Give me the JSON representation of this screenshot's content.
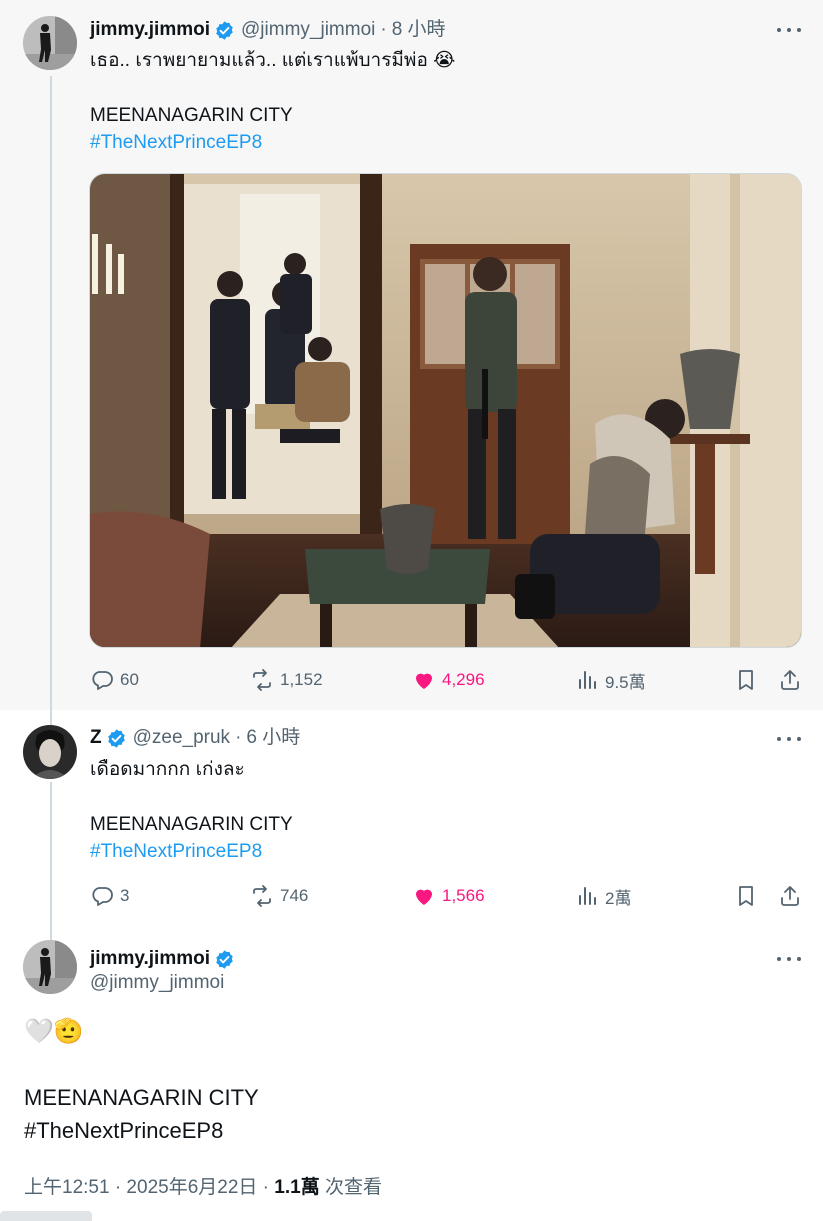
{
  "tweets": [
    {
      "display_name": "jimmy.jimmoi",
      "handle": "@jimmy_jimmoi",
      "time": "8 小時",
      "text_line1": "เธอ.. เราพยายามแล้ว.. แต่เราแพ้บารมีพ่อ 😭",
      "text_line2": "MEENANAGARIN CITY",
      "hashtag": "#TheNextPrinceEP8",
      "replies": "60",
      "retweets": "1,152",
      "likes": "4,296",
      "views": "9.5萬"
    },
    {
      "display_name": "Z",
      "handle": "@zee_pruk",
      "time": "6 小時",
      "text_line1": "เดือดมากกก เก่งละ",
      "text_line2": "MEENANAGARIN CITY",
      "hashtag": "#TheNextPrinceEP8",
      "replies": "3",
      "retweets": "746",
      "likes": "1,566",
      "views": "2萬"
    },
    {
      "display_name": "jimmy.jimmoi",
      "handle": "@jimmy_jimmoi",
      "emoji": "🤍🫡",
      "text_line2": "MEENANAGARIN CITY",
      "hashtag": "#TheNextPrinceEP8",
      "timestamp": "上午12:51 · 2025年6月22日 · ",
      "view_count": "1.1萬",
      "view_suffix": " 次查看"
    }
  ],
  "colors": {
    "accent": "#1d9bf0",
    "like": "#f91880",
    "secondary_text": "#536471",
    "verified": "#1d9bf0"
  },
  "icons": [
    "reply-icon",
    "retweet-icon",
    "heart-icon",
    "views-icon",
    "bookmark-icon",
    "share-icon",
    "verified-badge-icon",
    "more-icon"
  ]
}
